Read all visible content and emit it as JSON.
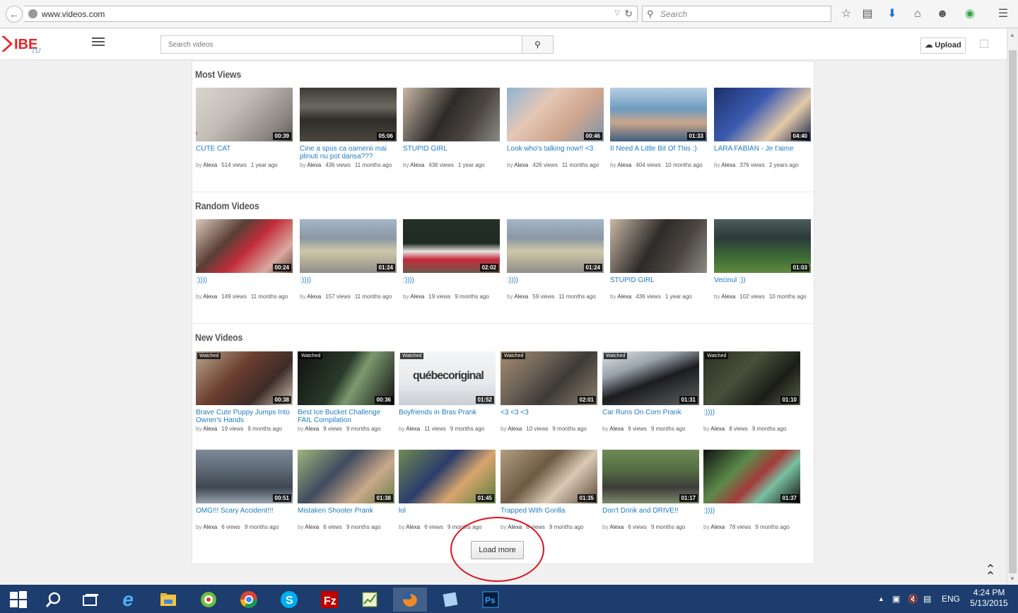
{
  "browser": {
    "url": "www.videos.com",
    "search_placeholder": "Search"
  },
  "site": {
    "search_placeholder": "Search videos",
    "upload_label": "Upload",
    "load_more_label": "Load more"
  },
  "sections": [
    {
      "title": "Most Views",
      "videos": [
        {
          "title": "CUTE CAT",
          "duration": "00:39",
          "author": "Alexa",
          "views": "514 views",
          "ago": "1 year ago"
        },
        {
          "title": "Cine a spus ca oamenii mai plinuti nu pot dansa???",
          "duration": "05:06",
          "author": "Alexa",
          "views": "436 views",
          "ago": "11 months ago"
        },
        {
          "title": "STUPID GIRL",
          "duration": "",
          "author": "Alexa",
          "views": "436 views",
          "ago": "1 year ago"
        },
        {
          "title": "Look who's talking now!! <3",
          "duration": "00:46",
          "author": "Alexa",
          "views": "426 views",
          "ago": "11 months ago"
        },
        {
          "title": "II Need A Little Bit Of This :)",
          "duration": "01:33",
          "author": "Alexa",
          "views": "404 views",
          "ago": "10 months ago"
        },
        {
          "title": "LARA FABIAN - Je t'aime",
          "duration": "04:40",
          "author": "Alexa",
          "views": "376 views",
          "ago": "2 years ago"
        }
      ]
    },
    {
      "title": "Random Videos",
      "videos": [
        {
          "title": ":))))",
          "duration": "00:24",
          "author": "Alexa",
          "views": "149 views",
          "ago": "11 months ago"
        },
        {
          "title": ":))))",
          "duration": "01:24",
          "author": "Alexa",
          "views": "157 views",
          "ago": "11 months ago"
        },
        {
          "title": ":))))",
          "duration": "02:02",
          "author": "Alexa",
          "views": "19 views",
          "ago": "9 months ago"
        },
        {
          "title": ":))))",
          "duration": "01:24",
          "author": "Alexa",
          "views": "59 views",
          "ago": "11 months ago"
        },
        {
          "title": "STUPID GIRL",
          "duration": "",
          "author": "Alexa",
          "views": "436 views",
          "ago": "1 year ago"
        },
        {
          "title": "Vecinul :))",
          "duration": "01:03",
          "author": "Alexa",
          "views": "102 views",
          "ago": "10 months ago"
        }
      ]
    },
    {
      "title": "New Videos",
      "watched_label": "Watched",
      "videos": [
        {
          "title": "Brave Cute Puppy Jumps Into Owner's Hands",
          "duration": "00:38",
          "author": "Alexa",
          "views": "19 views",
          "ago": "9 months ago",
          "watched": true
        },
        {
          "title": "Best Ice Bucket Challenge FAIL Compilation",
          "duration": "00:36",
          "author": "Alexa",
          "views": "9 views",
          "ago": "9 months ago",
          "watched": true
        },
        {
          "title": "Boyfriends in Bras Prank",
          "duration": "01:52",
          "author": "Alexa",
          "views": "11 views",
          "ago": "9 months ago",
          "watched": true,
          "thumb_text": "québecoriginal"
        },
        {
          "title": "<3 <3 <3",
          "duration": "02:01",
          "author": "Alexa",
          "views": "10 views",
          "ago": "9 months ago",
          "watched": true
        },
        {
          "title": "Car Runs On Corn Prank",
          "duration": "01:31",
          "author": "Alexa",
          "views": "9 views",
          "ago": "9 months ago",
          "watched": true
        },
        {
          "title": ":))))",
          "duration": "01:10",
          "author": "Alexa",
          "views": "8 views",
          "ago": "9 months ago",
          "watched": true
        },
        {
          "title": "OMG!!! Scary Accident!!!",
          "duration": "00:51",
          "author": "Alexa",
          "views": "6 views",
          "ago": "9 months ago"
        },
        {
          "title": "Mistaken Shooter Prank",
          "duration": "01:38",
          "author": "Alexa",
          "views": "6 views",
          "ago": "9 months ago"
        },
        {
          "title": "lol",
          "duration": "01:45",
          "author": "Alexa",
          "views": "6 views",
          "ago": "9 months ago"
        },
        {
          "title": "Trapped With Gorilla",
          "duration": "01:35",
          "author": "Alexa",
          "views": "6 views",
          "ago": "9 months ago"
        },
        {
          "title": "Don't Drink and DRIVE!!",
          "duration": "01:17",
          "author": "Alexa",
          "views": "6 views",
          "ago": "9 months ago"
        },
        {
          "title": ":))))",
          "duration": "01:37",
          "author": "Alexa",
          "views": "78 views",
          "ago": "9 months ago"
        }
      ]
    }
  ],
  "by_label": "by",
  "taskbar": {
    "language": "ENG",
    "time": "4:24 PM",
    "date": "5/13/2015"
  }
}
